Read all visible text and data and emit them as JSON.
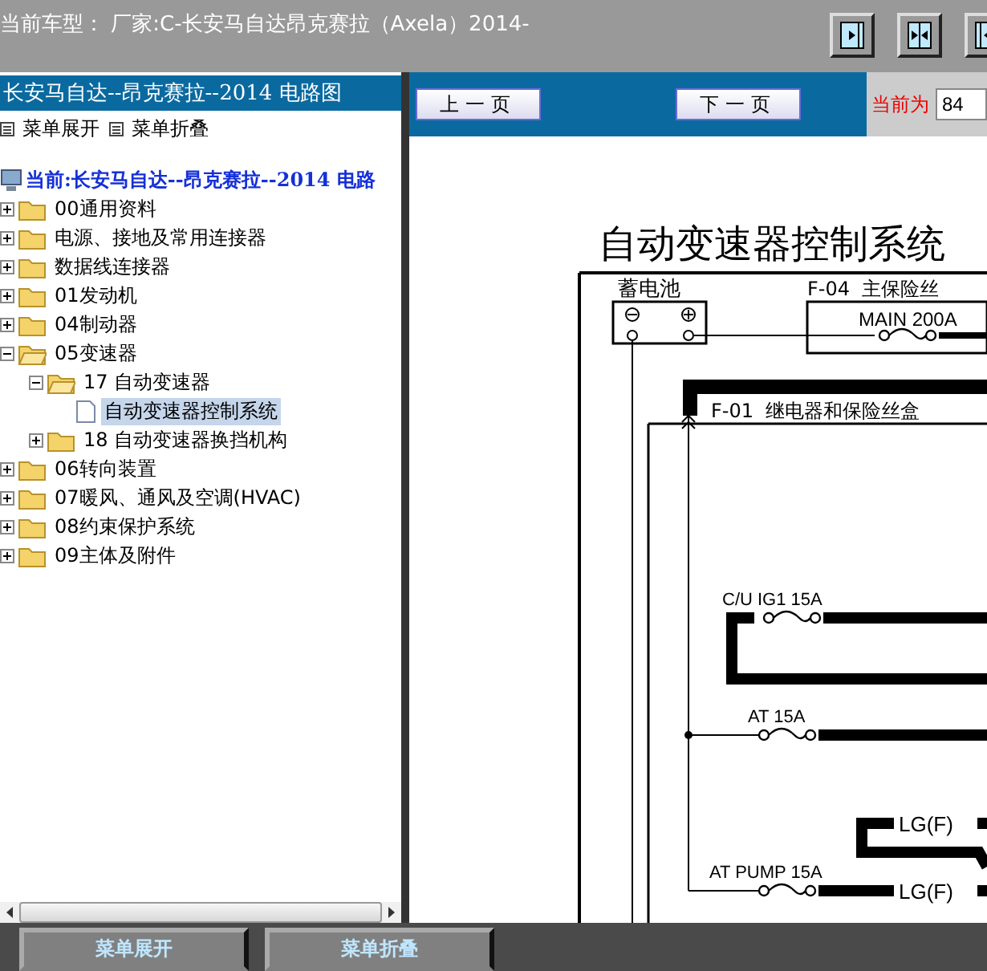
{
  "header": {
    "text": "当前车型： 厂家:C-长安马自达昂克赛拉（Axela）2014-"
  },
  "sidebar": {
    "title": "长安马自达--昂克赛拉--2014 电路图",
    "menu": [
      "菜单展开",
      "菜单折叠"
    ],
    "current": "当前:长安马自达--昂克赛拉--2014 电路",
    "tree": [
      {
        "kind": "folder",
        "label": "00通用资料",
        "expanded": false,
        "selected": false
      },
      {
        "kind": "folder",
        "label": "电源、接地及常用连接器",
        "expanded": false,
        "selected": false
      },
      {
        "kind": "folder",
        "label": "数据线连接器",
        "expanded": false,
        "selected": false
      },
      {
        "kind": "folder",
        "label": "01发动机",
        "expanded": false,
        "selected": false
      },
      {
        "kind": "folder",
        "label": "04制动器",
        "expanded": false,
        "selected": false
      },
      {
        "kind": "folder",
        "label": "05变速器",
        "expanded": true,
        "selected": false,
        "children": [
          {
            "kind": "folder",
            "label": "17 自动变速器",
            "expanded": true,
            "selected": false,
            "children": [
              {
                "kind": "document",
                "label": "自动变速器控制系统",
                "selected": true
              }
            ]
          },
          {
            "kind": "folder",
            "label": "18 自动变速器换挡机构",
            "expanded": false,
            "selected": false
          }
        ]
      },
      {
        "kind": "folder",
        "label": "06转向装置",
        "expanded": false,
        "selected": false
      },
      {
        "kind": "folder",
        "label": "07暖风、通风及空调(HVAC)",
        "expanded": false,
        "selected": false
      },
      {
        "kind": "folder",
        "label": "08约束保护系统",
        "expanded": false,
        "selected": false
      },
      {
        "kind": "folder",
        "label": "09主体及附件",
        "expanded": false,
        "selected": false
      }
    ]
  },
  "pager": {
    "prev": "上一页",
    "next": "下一页",
    "current_label": "当前为",
    "current_value": "84"
  },
  "diagram": {
    "title": "自动变速器控制系统",
    "battery": "蓄电池",
    "main_fuse_box": "F-04  主保险丝",
    "main_fuse": "MAIN 200A",
    "relay_box": "F-01  继电器和保险丝盒",
    "fuses": [
      "C/U IG1 15A",
      "AT 15A",
      "AT PUMP 15A"
    ],
    "connectors": [
      "LG(F)",
      "LG(F)"
    ]
  },
  "bottom_buttons": [
    "菜单展开",
    "菜单折叠"
  ]
}
